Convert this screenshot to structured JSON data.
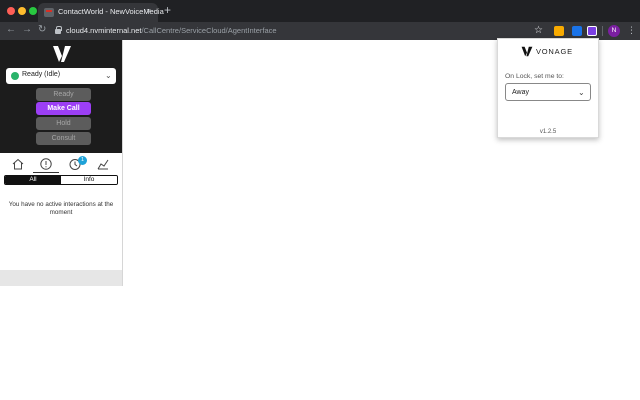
{
  "browser": {
    "tab_title": "ContactWorld - NewVoiceMedia",
    "tab_close": "×",
    "new_tab": "+",
    "url_host": "cloud4.nvminternal.net",
    "url_path": "/CallCentre/ServiceCloud/AgentInterface",
    "back_icon": "←",
    "forward_icon": "→",
    "reload_icon": "↻",
    "star_icon": "☆",
    "menu_icon": "⋮",
    "profile_initial": "N"
  },
  "agent_panel": {
    "status_value": "Ready (Idle)",
    "status_chevron": "⌄",
    "buttons": {
      "ready": "Ready",
      "make_call": "Make Call",
      "hold": "Hold",
      "consult": "Consult"
    },
    "tabs": [
      "home",
      "active-interactions",
      "history",
      "stats"
    ],
    "history_badge": "1",
    "filters": {
      "all": "All",
      "info": "Info"
    },
    "empty_message": "You have no active interactions at the moment"
  },
  "popup": {
    "brand": "VONAGE",
    "lock_label": "On Lock, set me to:",
    "lock_value": "Away",
    "select_chevron": "⌄",
    "version": "v1.2.5"
  },
  "colors": {
    "accent_purple": "#9c3ff5",
    "ready_green": "#29b36a",
    "badge_blue": "#1ea2d8",
    "chrome_dark": "#202124"
  }
}
